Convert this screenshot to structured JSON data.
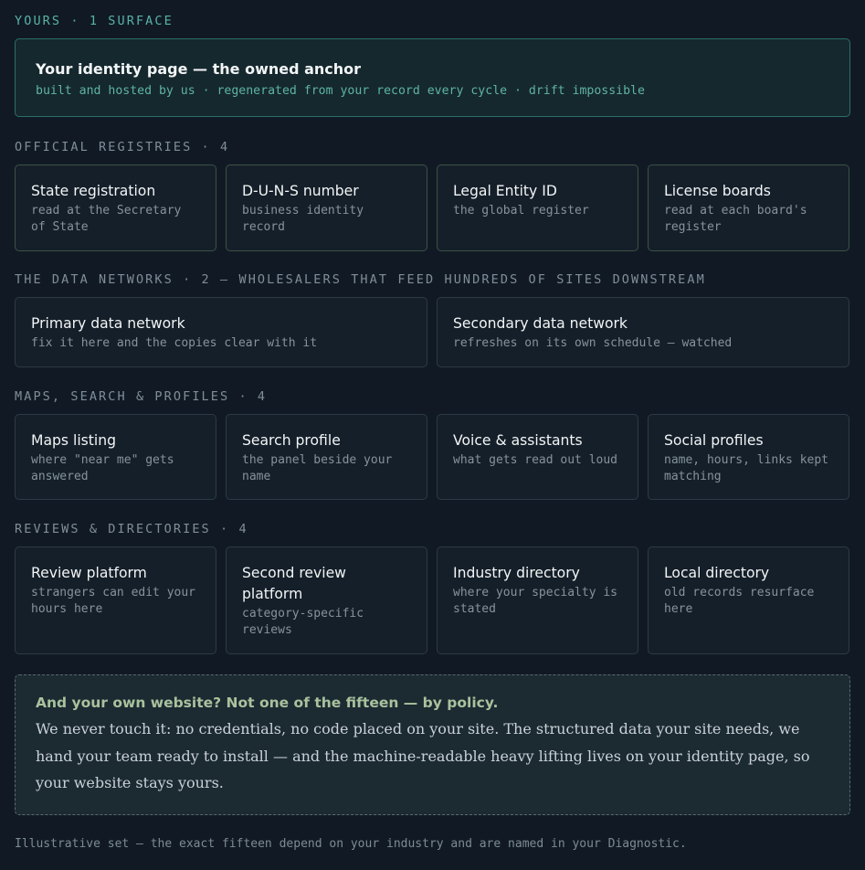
{
  "yours": {
    "label": "YOURS · 1 SURFACE",
    "title": "Your identity page — the owned anchor",
    "subtitle": "built and hosted by us · regenerated from your record every cycle · drift impossible"
  },
  "registries": {
    "label": "OFFICIAL REGISTRIES · 4",
    "cards": [
      {
        "title": "State registration",
        "desc": "read at the Secretary of State"
      },
      {
        "title": "D-U-N-S number",
        "desc": "business identity record"
      },
      {
        "title": "Legal Entity ID",
        "desc": "the global register"
      },
      {
        "title": "License boards",
        "desc": "read at each board's register"
      }
    ]
  },
  "networks": {
    "label": "THE DATA NETWORKS · 2 — WHOLESALERS THAT FEED HUNDREDS OF SITES DOWNSTREAM",
    "cards": [
      {
        "title": "Primary data network",
        "desc": "fix it here and the copies clear with it"
      },
      {
        "title": "Secondary data network",
        "desc": "refreshes on its own schedule — watched"
      }
    ]
  },
  "maps": {
    "label": "MAPS, SEARCH & PROFILES · 4",
    "cards": [
      {
        "title": "Maps listing",
        "desc": "where \"near me\" gets answered"
      },
      {
        "title": "Search profile",
        "desc": "the panel beside your name"
      },
      {
        "title": "Voice & assistants",
        "desc": "what gets read out loud"
      },
      {
        "title": "Social profiles",
        "desc": "name, hours, links kept matching"
      }
    ]
  },
  "reviews": {
    "label": "REVIEWS & DIRECTORIES · 4",
    "cards": [
      {
        "title": "Review platform",
        "desc": "strangers can edit your hours here"
      },
      {
        "title": "Second review platform",
        "desc": "category-specific reviews"
      },
      {
        "title": "Industry directory",
        "desc": "where your specialty is stated"
      },
      {
        "title": "Local directory",
        "desc": "old records resurface here"
      }
    ]
  },
  "policy": {
    "title": "And your own website? Not one of the fifteen — by policy.",
    "text": "We never touch it: no credentials, no code placed on your site. The structured data your site needs, we hand your team ready to install — and the machine-readable heavy lifting lives on your identity page, so your website stays yours."
  },
  "footer": {
    "note": "Illustrative set — the exact fifteen depend on your industry and are named in your Diagnostic."
  },
  "colors": {
    "background": "#111a24",
    "accent_teal": "#5fb3a5",
    "accent_green": "#a9c29d"
  }
}
